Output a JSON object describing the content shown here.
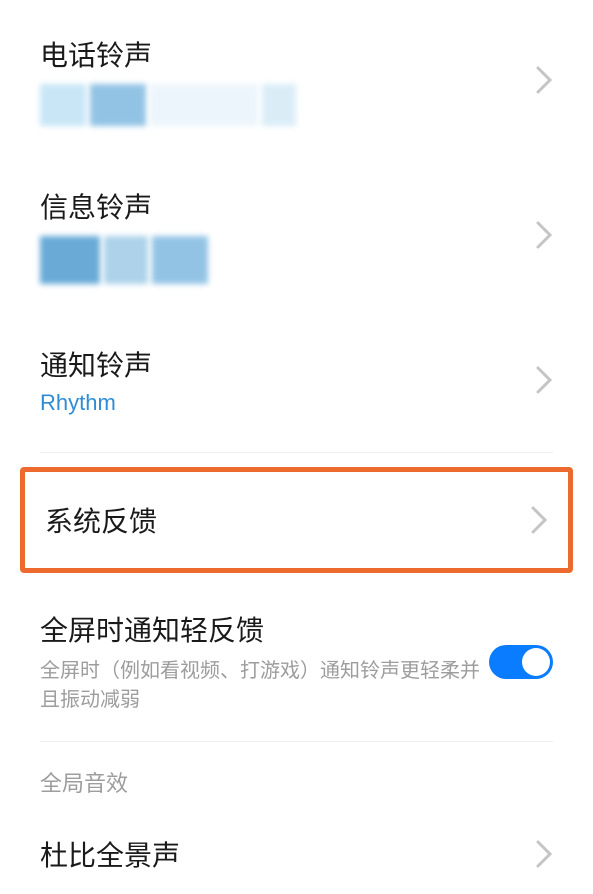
{
  "rows": {
    "phone_ringtone": {
      "title": "电话铃声"
    },
    "message_ringtone": {
      "title": "信息铃声"
    },
    "notification_ringtone": {
      "title": "通知铃声",
      "subtitle": "Rhythm"
    },
    "system_feedback": {
      "title": "系统反馈"
    },
    "fullscreen_light_feedback": {
      "title": "全屏时通知轻反馈",
      "desc": "全屏时（例如看视频、打游戏）通知铃声更轻柔并且振动减弱"
    },
    "dolby_atmos": {
      "title": "杜比全景声"
    }
  },
  "section": {
    "global_effects": "全局音效"
  }
}
